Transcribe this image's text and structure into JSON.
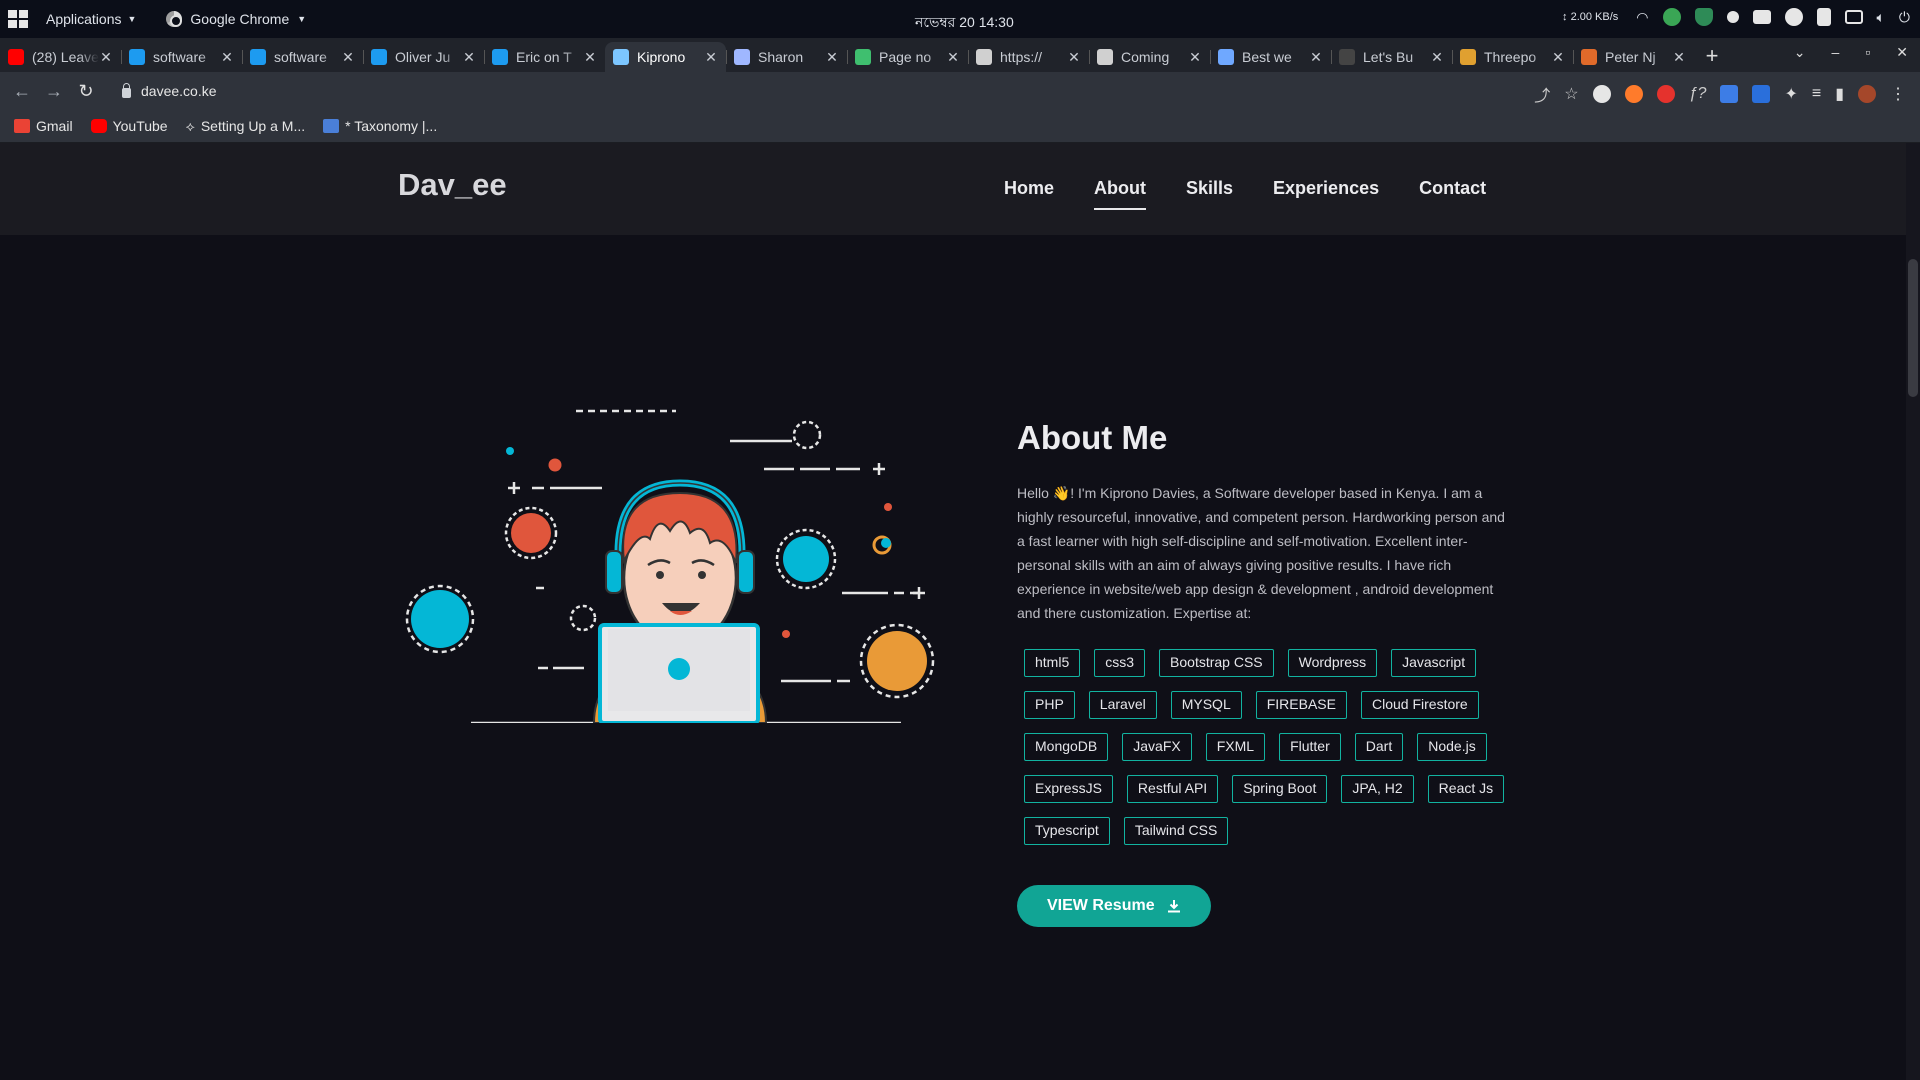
{
  "os": {
    "menu_label": "Applications",
    "app_label": "Google Chrome",
    "clock": "নভেম্বর 20  14:30",
    "net_speed": "↕ 2.00 KB/s"
  },
  "tabs": [
    {
      "title": "(28) Leave",
      "color": "#ff0000"
    },
    {
      "title": "software",
      "color": "#1d9bf0"
    },
    {
      "title": "software",
      "color": "#1d9bf0"
    },
    {
      "title": "Oliver Ju",
      "color": "#1d9bf0"
    },
    {
      "title": "Eric on T",
      "color": "#1d9bf0"
    },
    {
      "title": "Kiprono",
      "color": "#7cc6ff"
    },
    {
      "title": "Sharon",
      "color": "#9fb7ff"
    },
    {
      "title": "Page no",
      "color": "#3fbf6f"
    },
    {
      "title": "https://",
      "color": "#d0d0d0"
    },
    {
      "title": "Coming",
      "color": "#d0d0d0"
    },
    {
      "title": "Best we",
      "color": "#6fa8ff"
    },
    {
      "title": "Let's Bu",
      "color": "#444444"
    },
    {
      "title": "Threepo",
      "color": "#e0a030"
    },
    {
      "title": "Peter Nj",
      "color": "#e06a2a"
    }
  ],
  "address": {
    "url": "davee.co.ke"
  },
  "bookmarks": [
    {
      "label": "Gmail",
      "color": "#ea4335"
    },
    {
      "label": "YouTube",
      "color": "#ff0000"
    },
    {
      "label": "Setting Up a M...",
      "color": "#e5e5e5"
    },
    {
      "label": "* Taxonomy |...",
      "color": "#4a7fd8"
    }
  ],
  "site": {
    "logo": "Dav_ee",
    "nav": [
      "Home",
      "About",
      "Skills",
      "Experiences",
      "Contact"
    ],
    "about_title": "About Me",
    "about_text": "Hello 👋! I'm Kiprono Davies, a Software developer based in Kenya. I am a highly resourceful, innovative, and competent person. Hardworking person and a fast learner with high self-discipline and self-motivation. Excellent inter-personal skills with an aim of always giving positive results. I have rich experience in website/web app design & development , android development and there customization. Expertise at:",
    "skills": [
      "html5",
      "css3",
      "Bootstrap CSS",
      "Wordpress",
      "Javascript",
      "PHP",
      "Laravel",
      "MYSQL",
      "FIREBASE",
      "Cloud Firestore",
      "MongoDB",
      "JavaFX",
      "FXML",
      "Flutter",
      "Dart",
      "Node.js",
      "ExpressJS",
      "Restful API",
      "Spring Boot",
      "JPA, H2",
      "React Js",
      "Typescript",
      "Tailwind CSS"
    ],
    "resume_label": "VIEW Resume",
    "accent": "#11a595"
  }
}
